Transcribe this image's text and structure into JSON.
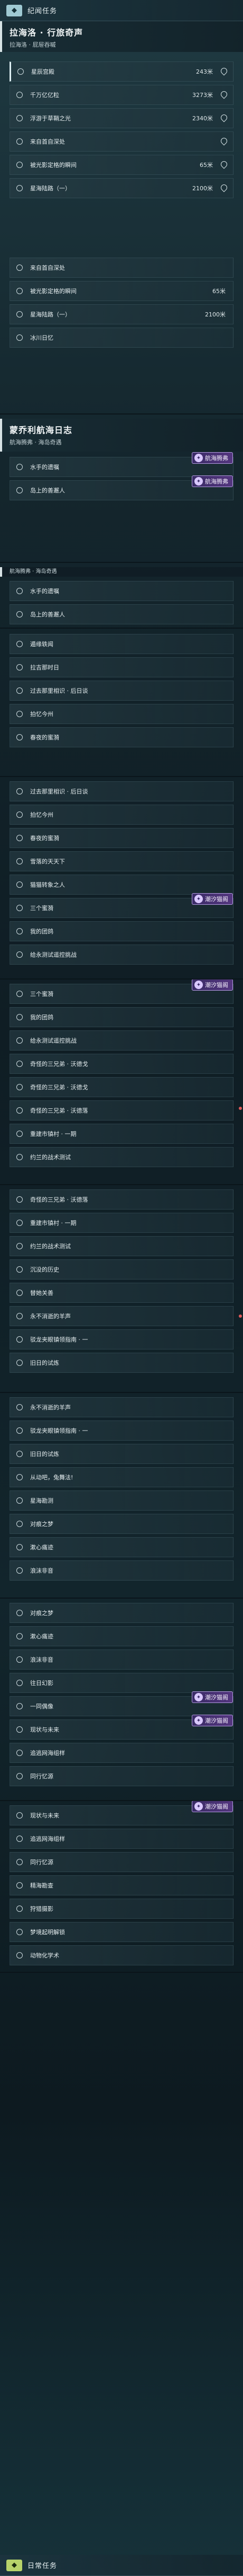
{
  "sections": {
    "top": {
      "icon": "◆",
      "title": "纪闻任务"
    },
    "bottom": {
      "icon": "◆",
      "title": "日常任务"
    }
  },
  "groups": {
    "g1": {
      "title": "拉海洛 · 行旅奇声",
      "subtitle": "拉海洛 · 屁屉吞嘁"
    },
    "g2": {
      "title": "蒙乔利航海日志",
      "subtitle": "航海腾弗 · 海岛奇遇"
    },
    "g2_mini": "航海腾弗 · 海岛奇遇"
  },
  "badges": {
    "navigation": "航海腾弗",
    "tide": "潮汐猫阁"
  },
  "rows": [
    {
      "label": "星辰宫殿",
      "distance": "243米"
    },
    {
      "label": "千万亿亿粒",
      "distance": "3273米"
    },
    {
      "label": "浮游于草鞘之光",
      "distance": "2340米"
    },
    {
      "label": "来自首自深处",
      "distance": ""
    },
    {
      "label": "被光影定格的瞬间",
      "distance": "65米"
    },
    {
      "label": "星海陆路（一）",
      "distance": "2100米"
    },
    {
      "label": "来自首自深处",
      "distance": ""
    },
    {
      "label": "被光影定格的瞬间",
      "distance": "65米"
    },
    {
      "label": "星海陆路（一）",
      "distance": "2100米"
    },
    {
      "label": "冰川日忆",
      "distance": ""
    },
    {
      "label": "水手的遗嘱"
    },
    {
      "label": "岛上的善邂人"
    },
    {
      "label": "水手的遗嘱"
    },
    {
      "label": "岛上的善邂人"
    },
    {
      "label": "遁缘轶闻"
    },
    {
      "label": "拉吉那时日"
    },
    {
      "label": "过去那里相识 · 后日谈"
    },
    {
      "label": "拍忆今州"
    },
    {
      "label": "春夜的蜜漪"
    },
    {
      "label": "过去那里相识 · 后日谈"
    },
    {
      "label": "拍忆今州"
    },
    {
      "label": "春夜的蜜漪"
    },
    {
      "label": "雪落的天天下"
    },
    {
      "label": "猫猫转象之人"
    },
    {
      "label": "三个蜜漪"
    },
    {
      "label": "我的团鸽"
    },
    {
      "label": "给永测试遥控挑战"
    },
    {
      "label": "三个蜜漪"
    },
    {
      "label": "我的团鸽"
    },
    {
      "label": "给永测试遥控挑战"
    },
    {
      "label": "奇怪的三兄弟 · 沃德戈"
    },
    {
      "label": "奇怪的三兄弟 · 沃德戈"
    },
    {
      "label": "奇怪的三兄弟 · 沃德落"
    },
    {
      "label": "重建市镇村 · 一期"
    },
    {
      "label": "约兰的战术测试"
    },
    {
      "label": "奇怪的三兄弟 · 沃德落"
    },
    {
      "label": "重建市镇村 · 一期"
    },
    {
      "label": "约兰的战术测试"
    },
    {
      "label": "沉没的历史"
    },
    {
      "label": "替她关善"
    },
    {
      "label": "永不消逝的羊声"
    },
    {
      "label": "驳龙夹眼镇领指南 · 一"
    },
    {
      "label": "旧日的试炼"
    },
    {
      "label": "永不消逝的羊声"
    },
    {
      "label": "驳龙夹眼镇领指南 · 一"
    },
    {
      "label": "旧日的试炼"
    },
    {
      "label": "从动吧，兔舞法!"
    },
    {
      "label": "星海勘测"
    },
    {
      "label": "对痕之梦"
    },
    {
      "label": "漱心痛迹"
    },
    {
      "label": "浪沫非音"
    },
    {
      "label": "对痕之梦"
    },
    {
      "label": "漱心痛迹"
    },
    {
      "label": "浪沫非音"
    },
    {
      "label": "往日幻影"
    },
    {
      "label": "一同偶像"
    },
    {
      "label": "现状与未来"
    },
    {
      "label": "追逃网海组样"
    },
    {
      "label": "同行忆源"
    },
    {
      "label": "现状与未来"
    },
    {
      "label": "追逃网海组样"
    },
    {
      "label": "同行忆源"
    },
    {
      "label": "精海勘查"
    },
    {
      "label": "狩猎摄影"
    },
    {
      "label": "梦境起明解锁"
    },
    {
      "label": "动物化学术"
    }
  ]
}
